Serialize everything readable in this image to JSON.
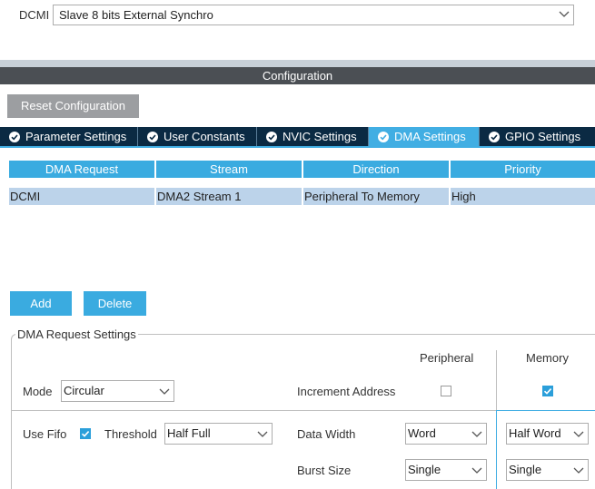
{
  "mode": {
    "label": "DCMI",
    "value": "Slave 8 bits External Synchro"
  },
  "config_title": "Configuration",
  "reset_label": "Reset Configuration",
  "tabs": [
    {
      "label": "Parameter Settings",
      "active": false
    },
    {
      "label": "User Constants",
      "active": false
    },
    {
      "label": "NVIC Settings",
      "active": false
    },
    {
      "label": "DMA Settings",
      "active": true
    },
    {
      "label": "GPIO Settings",
      "active": false
    }
  ],
  "dma_table": {
    "headers": [
      "DMA Request",
      "Stream",
      "Direction",
      "Priority"
    ],
    "rows": [
      [
        "DCMI",
        "DMA2 Stream 1",
        "Peripheral To Memory",
        "High"
      ]
    ]
  },
  "buttons": {
    "add": "Add",
    "delete": "Delete"
  },
  "settings": {
    "legend": "DMA Request Settings",
    "peripheral_header": "Peripheral",
    "memory_header": "Memory",
    "mode_label": "Mode",
    "mode_value": "Circular",
    "increment_label": "Increment Address",
    "increment_peripheral": false,
    "increment_memory": true,
    "use_fifo_label": "Use Fifo",
    "use_fifo_checked": true,
    "threshold_label": "Threshold",
    "threshold_value": "Half Full",
    "data_width_label": "Data Width",
    "data_width_peripheral": "Word",
    "data_width_memory": "Half Word",
    "burst_size_label": "Burst Size",
    "burst_size_peripheral": "Single",
    "burst_size_memory": "Single"
  },
  "colors": {
    "accent": "#41aee3",
    "tab_bar": "#0b2a43",
    "config_bar": "#4b4f54",
    "row_selected": "#bcd3ea"
  }
}
